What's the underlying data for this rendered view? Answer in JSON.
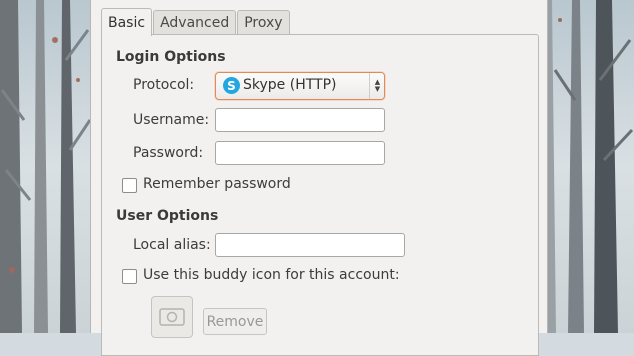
{
  "tabs": [
    {
      "label": "Basic",
      "active": true
    },
    {
      "label": "Advanced",
      "active": false
    },
    {
      "label": "Proxy",
      "active": false
    }
  ],
  "login_options": {
    "heading": "Login Options",
    "protocol": {
      "label": "Protocol:",
      "value": "Skype (HTTP)",
      "icon": "skype-icon"
    },
    "username": {
      "label": "Username:",
      "value": ""
    },
    "password": {
      "label": "Password:",
      "value": ""
    },
    "remember_password": {
      "label": "Remember password",
      "checked": false
    }
  },
  "user_options": {
    "heading": "User Options",
    "local_alias": {
      "label": "Local alias:",
      "value": ""
    },
    "buddy_icon": {
      "label": "Use this buddy icon for this account:",
      "checked": false
    },
    "remove_label": "Remove"
  },
  "colors": {
    "focus_border": "#e08a5a",
    "skype_blue": "#22a7e0"
  }
}
